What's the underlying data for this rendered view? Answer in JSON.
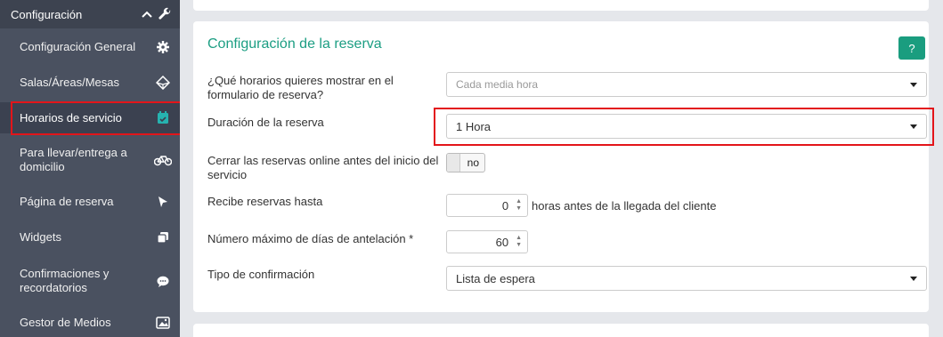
{
  "sidebar": {
    "header": {
      "title": "Configuración",
      "collapse_icon": "chevron-up-icon",
      "tools_icon": "wrench-icon"
    },
    "items": [
      {
        "label": "Configuración General",
        "icon": "gear-icon"
      },
      {
        "label": "Salas/Áreas/Mesas",
        "icon": "cube-icon"
      },
      {
        "label": "Horarios de servicio",
        "icon": "calendar-check-icon",
        "active": true
      },
      {
        "label": "Para llevar/entrega a domicilio",
        "icon": "bicycle-icon"
      },
      {
        "label": "Página de reserva",
        "icon": "cursor-icon"
      },
      {
        "label": "Widgets",
        "icon": "copy-icon"
      },
      {
        "label": "Confirmaciones y recordatorios",
        "icon": "chat-icon"
      },
      {
        "label": "Gestor de Medios",
        "icon": "image-icon"
      }
    ]
  },
  "panel": {
    "title": "Configuración de la reserva",
    "help_label": "?",
    "fields": {
      "horarios": {
        "label": "¿Qué horarios quieres mostrar en el formulario de reserva?",
        "placeholder": "Cada media hora"
      },
      "duracion": {
        "label": "Duración de la reserva",
        "value": "1 Hora"
      },
      "cerrar": {
        "label": "Cerrar las reservas online antes del inicio del servicio",
        "value": "no"
      },
      "hasta": {
        "label": "Recibe reservas hasta",
        "value": "0",
        "suffix": "horas antes de la llegada del cliente"
      },
      "maxdias": {
        "label": "Número máximo de días de antelación *",
        "value": "60"
      },
      "tipo": {
        "label": "Tipo de confirmación",
        "value": "Lista de espera"
      }
    }
  },
  "colors": {
    "sidebar_bg": "#4a5160",
    "accent": "#1a9d7f",
    "highlight": "#e3151a"
  }
}
